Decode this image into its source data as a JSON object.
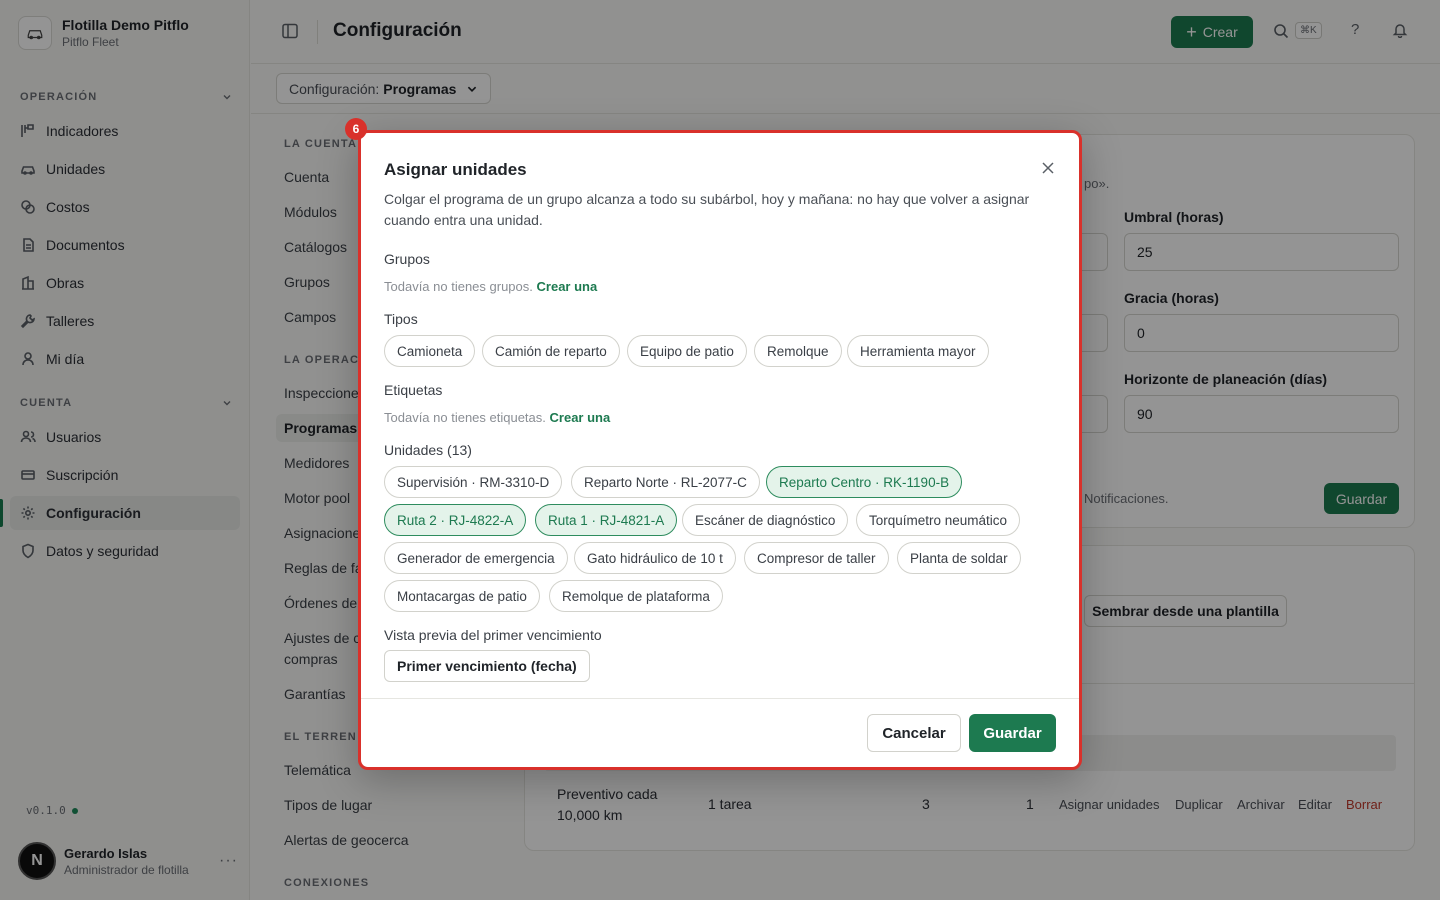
{
  "org": {
    "name": "Flotilla Demo Pitflo",
    "subtitle": "Pitflo Fleet"
  },
  "sidebar": {
    "section_operacion": "OPERACIÓN",
    "section_cuenta": "CUENTA",
    "operacion_items": [
      {
        "label": "Indicadores",
        "icon": "chart-icon"
      },
      {
        "label": "Unidades",
        "icon": "car-icon"
      },
      {
        "label": "Costos",
        "icon": "coins-icon"
      },
      {
        "label": "Documentos",
        "icon": "document-icon"
      },
      {
        "label": "Obras",
        "icon": "building-icon"
      },
      {
        "label": "Talleres",
        "icon": "wrench-icon"
      },
      {
        "label": "Mi día",
        "icon": "person-icon"
      }
    ],
    "cuenta_items": [
      {
        "label": "Usuarios",
        "icon": "users-icon"
      },
      {
        "label": "Suscripción",
        "icon": "card-icon"
      },
      {
        "label": "Configuración",
        "icon": "gear-icon",
        "active": true
      },
      {
        "label": "Datos y seguridad",
        "icon": "shield-icon"
      }
    ],
    "version": "v0.1.0",
    "user": {
      "initial": "N",
      "name": "Gerardo Islas",
      "role": "Administrador de flotilla",
      "more": "···"
    }
  },
  "header": {
    "title": "Configuración",
    "create_label": "Crear",
    "shortcut": "⌘K",
    "help": "?"
  },
  "subbar": {
    "select_prefix": "Configuración:",
    "select_value": "Programas"
  },
  "settings_nav": {
    "h1": "LA CUENTA",
    "items1": [
      "Cuenta",
      "Módulos",
      "Catálogos",
      "Grupos",
      "Campos"
    ],
    "h2": "LA OPERAC",
    "items2": [
      "Inspeccione",
      "Programas",
      "Medidores",
      "Motor pool",
      "Asignacione",
      "Reglas de fa",
      "Órdenes de",
      "Ajustes de c",
      "compras",
      "Garantías"
    ],
    "h3": "EL TERREN",
    "items3": [
      "Telemática",
      "Tipos de lugar",
      "Alertas de geocerca"
    ],
    "h4": "CONEXIONES"
  },
  "background": {
    "hint_text": "po».",
    "umbral_label": "Umbral (horas)",
    "umbral_value": "25",
    "gracia_label": "Gracia (horas)",
    "gracia_value": "0",
    "horizonte_label": "Horizonte de planeación (días)",
    "horizonte_value": "90",
    "notif_text": "Notificaciones.",
    "save_label": "Guardar",
    "seed_label": "Sembrar desde una plantilla",
    "row": {
      "name": "Preventivo cada 10,000 km",
      "tasks": "1 tarea",
      "count_a": "3",
      "count_b": "1",
      "actions": [
        "Asignar unidades",
        "Duplicar",
        "Archivar",
        "Editar",
        "Borrar"
      ]
    }
  },
  "modal": {
    "badge": "6",
    "title": "Asignar unidades",
    "description": "Colgar el programa de un grupo alcanza a todo su subárbol, hoy y mañana: no hay que volver a asignar cuando entra una unidad.",
    "grupos_label": "Grupos",
    "grupos_empty": "Todavía no tienes grupos.",
    "grupos_create": "Crear una",
    "tipos_label": "Tipos",
    "tipos": [
      "Camioneta",
      "Camión de reparto",
      "Equipo de patio",
      "Remolque",
      "Herramienta mayor"
    ],
    "etiquetas_label": "Etiquetas",
    "etiquetas_empty": "Todavía no tienes etiquetas.",
    "etiquetas_create": "Crear una",
    "unidades_label": "Unidades (13)",
    "unidades": [
      {
        "label": "Supervisión · RM-3310-D",
        "selected": false
      },
      {
        "label": "Reparto Norte · RL-2077-C",
        "selected": false
      },
      {
        "label": "Reparto Centro · RK-1190-B",
        "selected": true
      },
      {
        "label": "Ruta 2 · RJ-4822-A",
        "selected": true
      },
      {
        "label": "Ruta 1 · RJ-4821-A",
        "selected": true
      },
      {
        "label": "Escáner de diagnóstico",
        "selected": false
      },
      {
        "label": "Torquímetro neumático",
        "selected": false
      },
      {
        "label": "Generador de emergencia",
        "selected": false
      },
      {
        "label": "Gato hidráulico de 10 t",
        "selected": false
      },
      {
        "label": "Compresor de taller",
        "selected": false
      },
      {
        "label": "Planta de soldar",
        "selected": false
      },
      {
        "label": "Montacargas de patio",
        "selected": false
      },
      {
        "label": "Remolque de plataforma",
        "selected": false
      }
    ],
    "preview_label": "Vista previa del primer vencimiento",
    "preview_button": "Primer vencimiento (fecha)",
    "cancel_label": "Cancelar",
    "save_label": "Guardar"
  },
  "colors": {
    "accent": "#1d7a50",
    "highlight_border": "#d9312b",
    "selected_chip_bg": "#e4f3ea"
  }
}
